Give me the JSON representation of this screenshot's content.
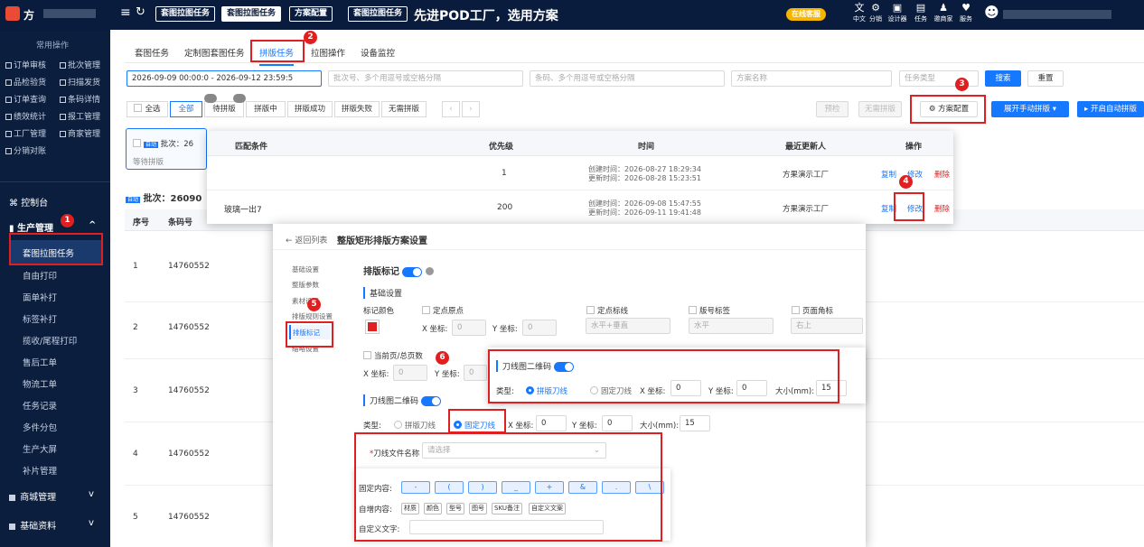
{
  "topbar": {
    "logo": "方",
    "menu_icon": "≡",
    "refresh_icon": "↻",
    "tabs": [
      "套图拉图任务",
      "套图拉图任务",
      "方案配置",
      "套图拉图任务"
    ],
    "banner": "先进POD工厂，选用方案",
    "promo": "在线客服",
    "promo_badge": "",
    "icons": [
      {
        "glyph": "文",
        "label": "中文"
      },
      {
        "glyph": "⚙",
        "label": "分销",
        "badge": "新版"
      },
      {
        "glyph": "▣",
        "label": "设计器"
      },
      {
        "glyph": "▤",
        "label": "任务"
      },
      {
        "glyph": "♟",
        "label": "邀商家"
      },
      {
        "glyph": "♥",
        "label": "服务"
      }
    ],
    "avatar": "☻"
  },
  "sidebar": {
    "quick_title": "常用操作",
    "quick": [
      [
        "订单审核",
        "批次管理"
      ],
      [
        "品检验货",
        "扫描发货"
      ],
      [
        "订单查询",
        "条码详情"
      ],
      [
        "绩效统计",
        "报工管理"
      ],
      [
        "工厂管理",
        "商家管理"
      ],
      [
        "分销对账",
        ""
      ]
    ],
    "sections": [
      {
        "label": "控制台",
        "icon": "⌘"
      },
      {
        "label": "生产管理",
        "icon": "▮",
        "caret": "^"
      }
    ],
    "sub": [
      "套图拉图任务",
      "自由打印",
      "面单补打",
      "标签补打",
      "揽收/尾程打印",
      "售后工单",
      "物流工单",
      "任务记录",
      "多件分包",
      "生产大屏",
      "补片管理"
    ],
    "bottom": [
      {
        "label": "商城管理",
        "caret": "v"
      },
      {
        "label": "基础资料",
        "caret": "v"
      }
    ]
  },
  "tabs": [
    "套图任务",
    "定制图套图任务",
    "拼版任务",
    "拉图操作",
    "设备监控"
  ],
  "filters": {
    "date": "2026-09-09 00:00:0 - 2026-09-12 23:59:5",
    "batch": "批次号、多个用逗号或空格分隔",
    "barcode": "条码、多个用逗号或空格分隔",
    "scheme": "方案名称",
    "type": "任务类型",
    "search": "搜索",
    "reset": "重置"
  },
  "status_tabs": [
    "全选",
    "全部",
    "待拼版",
    "拼版中",
    "拼版成功",
    "拼版失败",
    "无需拼版"
  ],
  "actions": {
    "precheck": "预检",
    "noneed": "无需拼版",
    "config": "方案配置",
    "manual": "展开手动拼版",
    "auto": "开启自动拼版"
  },
  "card": {
    "tag": "自动",
    "batch": "批次：26",
    "status": "等待拼版"
  },
  "batch_label": "批次：26090",
  "table_head": {
    "no": "序号",
    "code": "条码号"
  },
  "rows": [
    {
      "no": "1",
      "code": "14760552"
    },
    {
      "no": "2",
      "code": "14760552"
    },
    {
      "no": "3",
      "code": "14760552"
    },
    {
      "no": "4",
      "code": "14760552"
    },
    {
      "no": "5",
      "code": "14760552"
    }
  ],
  "popup": {
    "head": [
      "匹配条件",
      "优先级",
      "时间",
      "最近更新人",
      "操作"
    ],
    "rows": [
      {
        "cond": "",
        "priority": "1",
        "created": "创建时间：2026-08-27 18:29:34",
        "updated": "更新时间：2026-08-28 15:23:51",
        "user": "方果演示工厂",
        "ops": [
          "复制",
          "修改",
          "删除"
        ]
      },
      {
        "cond": "玻璃一出7",
        "priority": "200",
        "created": "创建时间：2026-09-08 15:47:55",
        "updated": "更新时间：2026-09-11 19:41:48",
        "user": "方果演示工厂",
        "ops": [
          "复制",
          "修改",
          "删除"
        ]
      }
    ]
  },
  "settings": {
    "back": "← 返回列表",
    "title": "整版矩形排版方案设置",
    "nav": [
      "基础设置",
      "整版参数",
      "素材设置",
      "排版规则设置",
      "排版标记",
      "缩略设置"
    ],
    "mark_title": "排版标记",
    "basic": "基础设置",
    "color_label": "标记颜色",
    "origin": "定点原点",
    "xlabel": "X 坐标:",
    "ylabel": "Y 坐标:",
    "zero": "0",
    "standard": "定点标线",
    "standard_val": "水平+垂直",
    "plate": "版号标签",
    "plate_val": "水平",
    "corner": "页面角标",
    "corner_val": "右上",
    "page": "当前页/总页数",
    "qr_title": "刀线图二维码",
    "type_label": "类型:",
    "opt1": "拼版刀线",
    "opt2": "固定刀线",
    "size_label": "大小(mm):",
    "size_val": "15",
    "file_label": "刀线文件名称",
    "file_ph": "请选择",
    "fixed_label": "固定内容:",
    "fixed": [
      "-",
      "(",
      ")",
      "_",
      "+",
      "&",
      ".",
      "\\"
    ],
    "auto_label": "自增内容:",
    "auto": [
      "材质",
      "颜色",
      "型号",
      "图号",
      "SKU备注",
      "自定义文案"
    ],
    "custom_label": "自定义文字:"
  },
  "annotations": [
    "1",
    "2",
    "3",
    "4",
    "5",
    "6"
  ],
  "colors": {
    "accent": "#1677ff",
    "annotate": "#e02020",
    "sidebar": "#0b1e3e"
  }
}
